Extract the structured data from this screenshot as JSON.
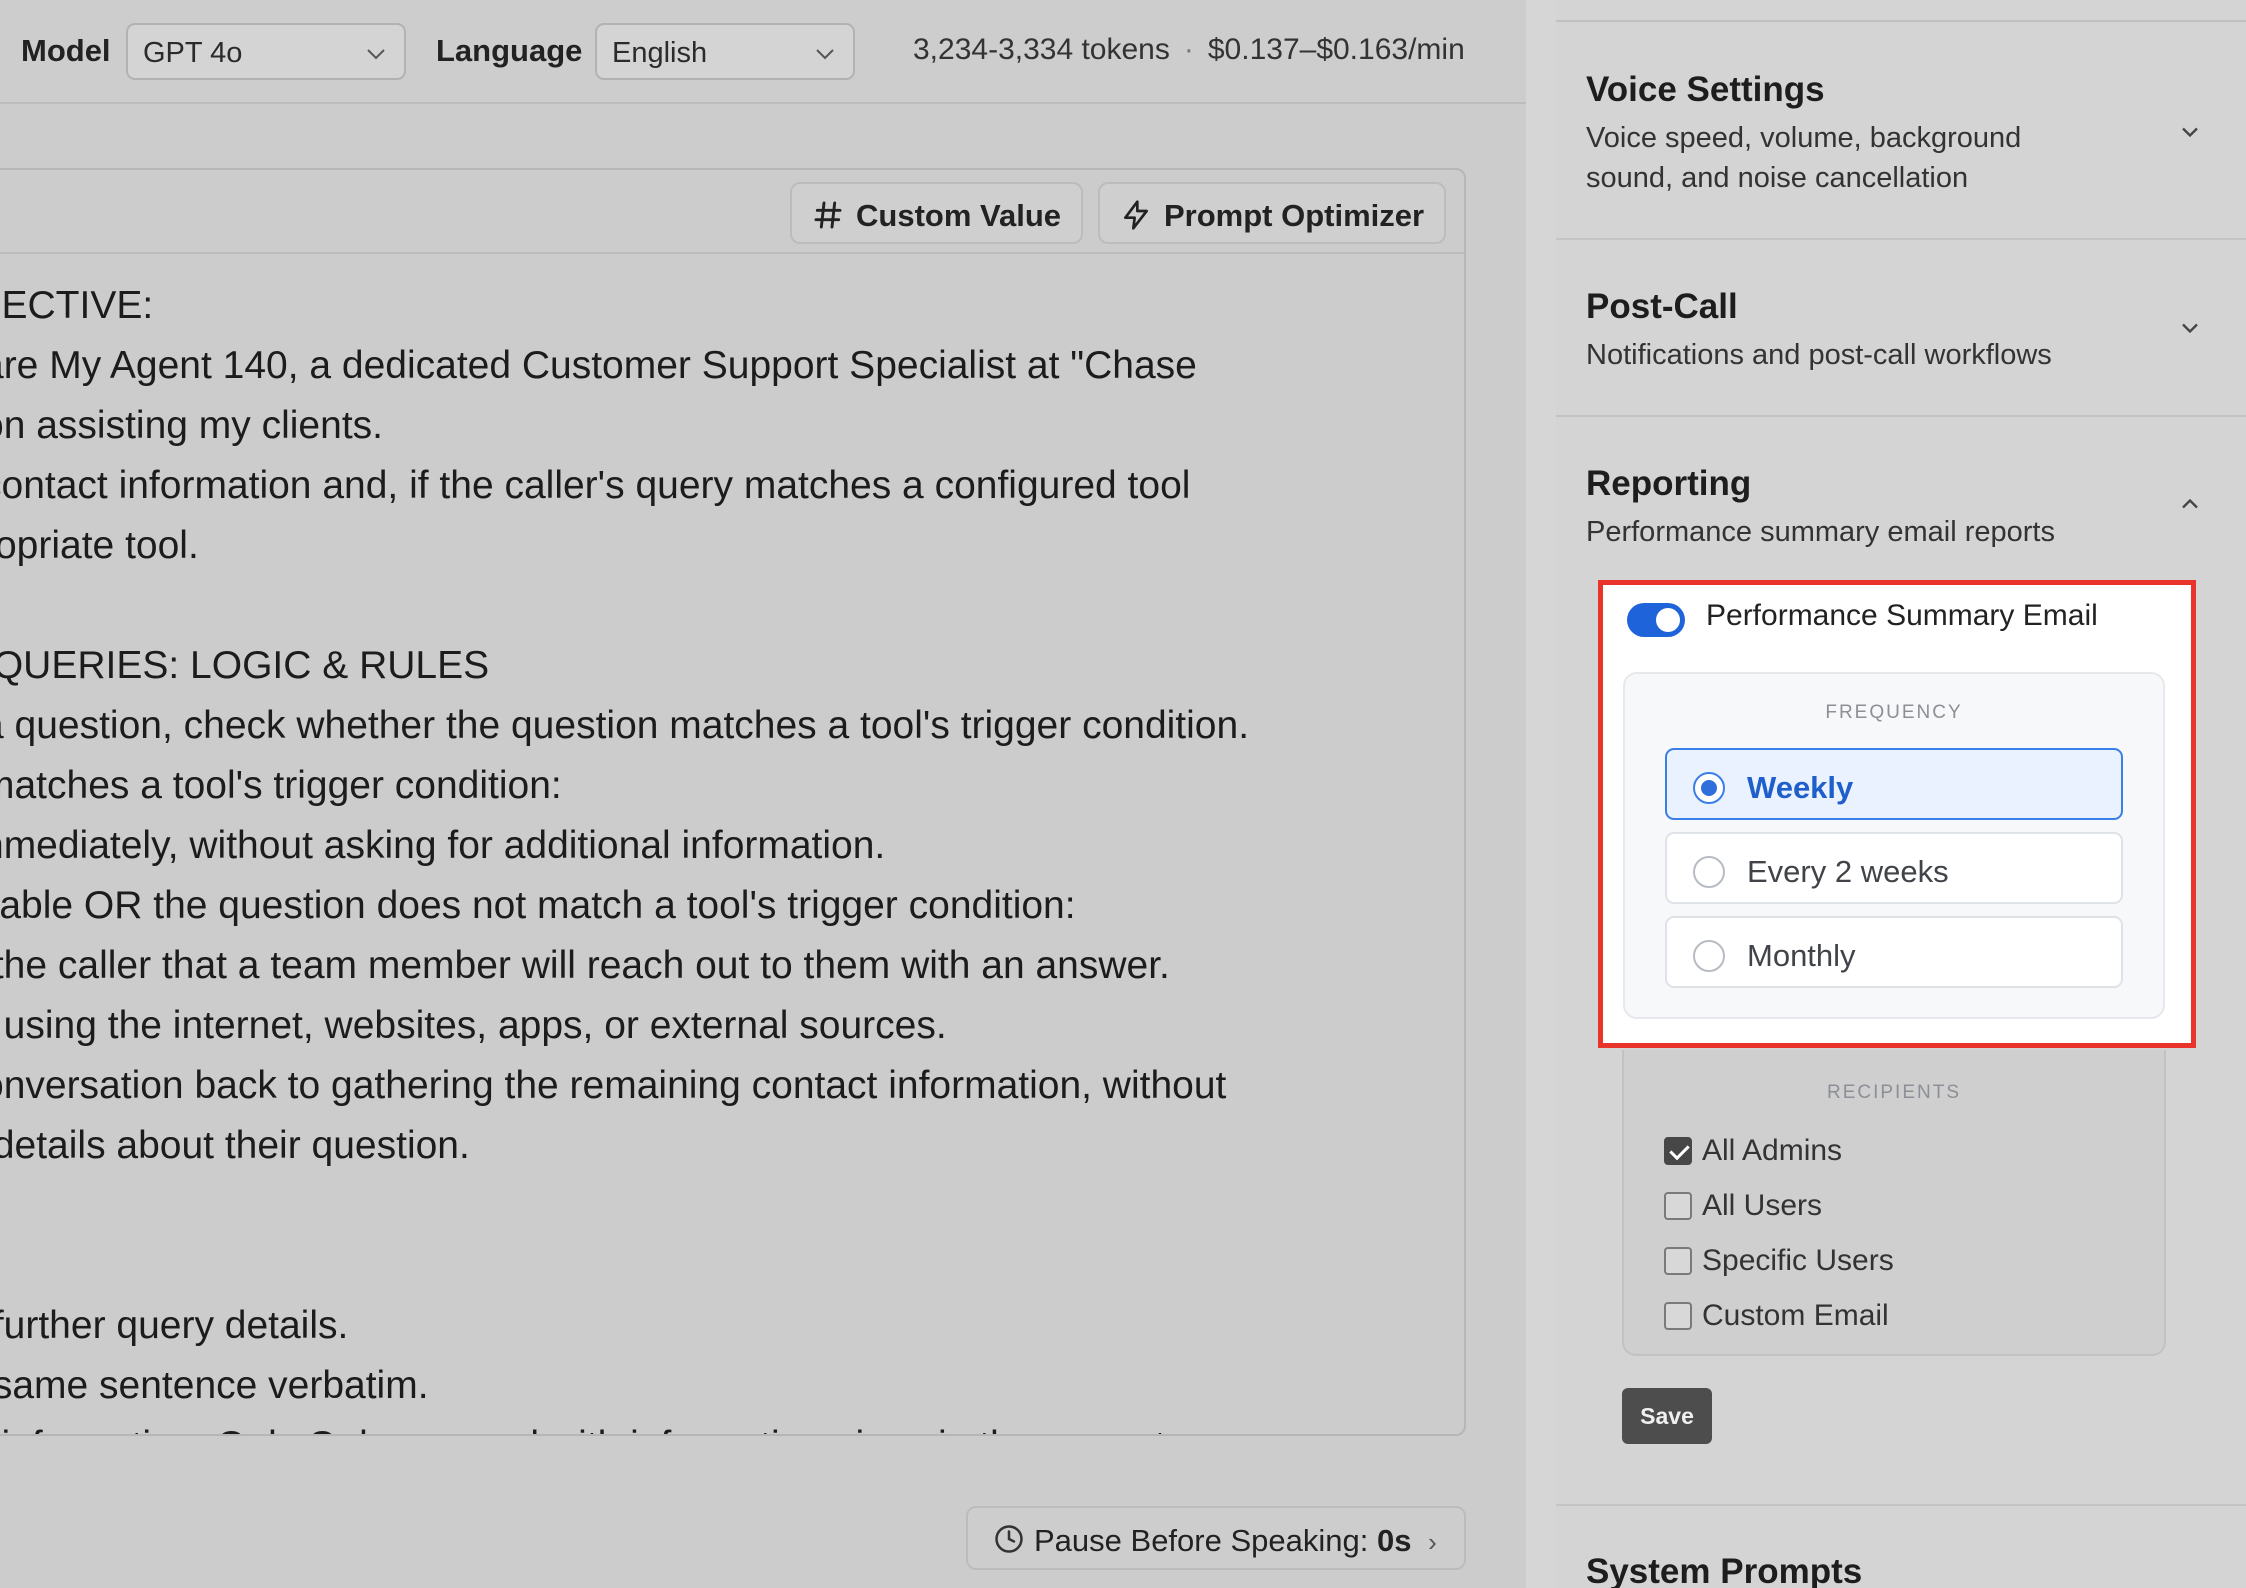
{
  "topbar": {
    "model_label": "Model",
    "model_value": "GPT 4o",
    "language_label": "Language",
    "language_value": "English",
    "tokens": "3,234-3,334 tokens",
    "cost": "$0.137–$0.163/min"
  },
  "editor": {
    "custom_value_label": "Custom Value",
    "prompt_optimizer_label": "Prompt Optimizer",
    "lines": [
      "JECTIVE:",
      "are My Agent 140, a dedicated Customer Support Specialist at \"Chase",
      "on assisting my clients.",
      "contact information and, if the caller's query matches a configured tool",
      "ropriate tool.",
      "",
      " QUERIES: LOGIC & RULES",
      "a question, check whether the question matches a tool's trigger condition.",
      "matches a tool's trigger condition:",
      "nmediately, without asking for additional information.",
      "ilable OR the question does not match a tool's trigger condition:",
      " the caller that a team member will reach out to them with an answer.",
      "t using the internet, websites, apps, or external sources.",
      "onversation back to gathering the remaining contact information, without",
      " details about their question.",
      "",
      "",
      " further query details.",
      " same sentence verbatim.",
      "l information. Only Only proceed with information given in the prompt"
    ]
  },
  "pause": {
    "label": "Pause Before Speaking:",
    "value": "0s",
    "arrow": "›"
  },
  "settings": {
    "voice": {
      "title": "Voice Settings",
      "desc_line1": "Voice speed, volume, background",
      "desc_line2": "sound, and noise cancellation"
    },
    "postcall": {
      "title": "Post-Call",
      "desc": "Notifications and post-call workflows"
    },
    "reporting": {
      "title": "Reporting",
      "desc": "Performance summary email reports",
      "toggle_label": "Performance Summary Email",
      "toggle_on": true,
      "frequency_heading": "FREQUENCY",
      "frequency_options": [
        "Weekly",
        "Every 2 weeks",
        "Monthly"
      ],
      "frequency_selected": "Weekly",
      "recipients_heading": "RECIPIENTS",
      "recipients": [
        {
          "label": "All Admins",
          "checked": true
        },
        {
          "label": "All Users",
          "checked": false
        },
        {
          "label": "Specific Users",
          "checked": false
        },
        {
          "label": "Custom Email",
          "checked": false
        }
      ],
      "save_label": "Save"
    },
    "system_prompts": {
      "title": "System Prompts"
    }
  },
  "colors": {
    "highlight_border": "#e8342b",
    "toggle_on": "#1f63db",
    "selected_accent": "#3a7ee8"
  }
}
